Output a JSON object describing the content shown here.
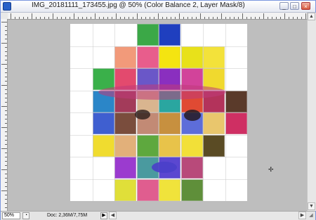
{
  "window": {
    "title": "IMG_20181111_173455.jpg @ 50% (Color Balance 2, Layer Mask/8)",
    "controls": {
      "minimize": "_",
      "maximize": "□",
      "close": "×"
    }
  },
  "status": {
    "zoom": "50%",
    "doc_info": "Doc: 2,36M/7,75M"
  },
  "icons": {
    "app": "photoshop-icon",
    "cursor": "cursor-icon"
  },
  "colors": {
    "accent_border": "#7a96df",
    "canvas_bg": "#bebebe"
  },
  "grid_cells": [
    {
      "c": 3,
      "r": 0,
      "color": "#3ba847"
    },
    {
      "c": 4,
      "r": 0,
      "color": "#1f3fbf"
    },
    {
      "c": 2,
      "r": 1,
      "color": "#f29a7a"
    },
    {
      "c": 3,
      "r": 1,
      "color": "#e85d8c"
    },
    {
      "c": 4,
      "r": 1,
      "color": "#f4e411"
    },
    {
      "c": 5,
      "r": 1,
      "color": "#e8e11a"
    },
    {
      "c": 6,
      "r": 1,
      "color": "#f3e23a"
    },
    {
      "c": 1,
      "r": 2,
      "color": "#3ab04a"
    },
    {
      "c": 2,
      "r": 2,
      "color": "#e34a6e"
    },
    {
      "c": 3,
      "r": 2,
      "color": "#6a57c8"
    },
    {
      "c": 4,
      "r": 2,
      "color": "#8a2fbf"
    },
    {
      "c": 5,
      "r": 2,
      "color": "#d2439a"
    },
    {
      "c": 6,
      "r": 2,
      "color": "#f0d92e"
    },
    {
      "c": 1,
      "r": 3,
      "color": "#2b86c8"
    },
    {
      "c": 2,
      "r": 3,
      "color": "#a33b5a"
    },
    {
      "c": 3,
      "r": 3,
      "color": "#d9b58f"
    },
    {
      "c": 4,
      "r": 3,
      "color": "#2aa6a0"
    },
    {
      "c": 5,
      "r": 3,
      "color": "#e04a33"
    },
    {
      "c": 6,
      "r": 3,
      "color": "#b3335b"
    },
    {
      "c": 7,
      "r": 3,
      "color": "#5a3a2a"
    },
    {
      "c": 1,
      "r": 4,
      "color": "#3f5fd0"
    },
    {
      "c": 2,
      "r": 4,
      "color": "#7a4d3d"
    },
    {
      "c": 3,
      "r": 4,
      "color": "#c28a75"
    },
    {
      "c": 4,
      "r": 4,
      "color": "#c7903f"
    },
    {
      "c": 5,
      "r": 4,
      "color": "#5d6dd9"
    },
    {
      "c": 6,
      "r": 4,
      "color": "#e9c66d"
    },
    {
      "c": 7,
      "r": 4,
      "color": "#cf2f63"
    },
    {
      "c": 1,
      "r": 5,
      "color": "#f0dc2f"
    },
    {
      "c": 2,
      "r": 5,
      "color": "#e2b07a"
    },
    {
      "c": 3,
      "r": 5,
      "color": "#5ea83e"
    },
    {
      "c": 4,
      "r": 5,
      "color": "#e8c34a"
    },
    {
      "c": 5,
      "r": 5,
      "color": "#f2e038"
    },
    {
      "c": 6,
      "r": 5,
      "color": "#5a4b24"
    },
    {
      "c": 2,
      "r": 6,
      "color": "#9b3bcf"
    },
    {
      "c": 3,
      "r": 6,
      "color": "#4a9a9f"
    },
    {
      "c": 4,
      "r": 6,
      "color": "#5b47d0"
    },
    {
      "c": 5,
      "r": 6,
      "color": "#b84a7a"
    },
    {
      "c": 2,
      "r": 7,
      "color": "#e0df39"
    },
    {
      "c": 3,
      "r": 7,
      "color": "#e05d8f"
    },
    {
      "c": 4,
      "r": 7,
      "color": "#f0e33b"
    },
    {
      "c": 5,
      "r": 7,
      "color": "#5f8f3a"
    }
  ]
}
